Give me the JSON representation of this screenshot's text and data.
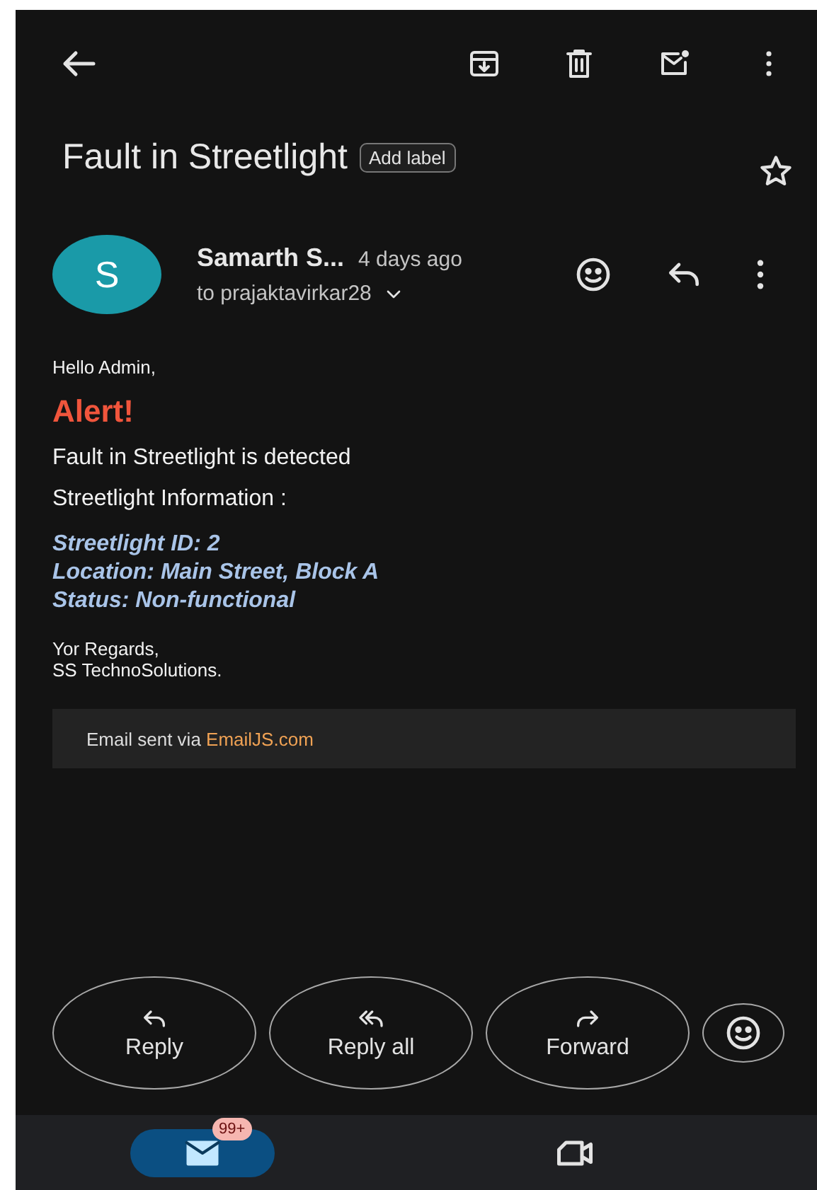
{
  "subject": "Fault in Streetlight",
  "label_button": "Add label",
  "starred": false,
  "sender": {
    "initial": "S",
    "name": "Samarth S...",
    "time": "4 days ago",
    "recipient": "to prajaktavirkar28"
  },
  "body": {
    "greeting": "Hello Admin,",
    "alert": "Alert!",
    "message": "Fault in Streetlight is detected",
    "info_heading": "Streetlight Information :",
    "details": [
      "Streetlight ID: 2",
      "Location: Main Street, Block A",
      "Status: Non-functional"
    ],
    "closing": [
      "Yor Regards,",
      "SS TechnoSolutions."
    ],
    "footer": {
      "text": "Email sent via ",
      "link": "EmailJS.com"
    }
  },
  "actions": [
    {
      "kind": "reply",
      "label": "Reply"
    },
    {
      "kind": "reply_all",
      "label": "Reply all"
    },
    {
      "kind": "forward",
      "label": "Forward"
    }
  ],
  "nav": [
    {
      "kind": "mail",
      "selected": true,
      "badge": "99+"
    },
    {
      "kind": "meet",
      "selected": false
    }
  ]
}
